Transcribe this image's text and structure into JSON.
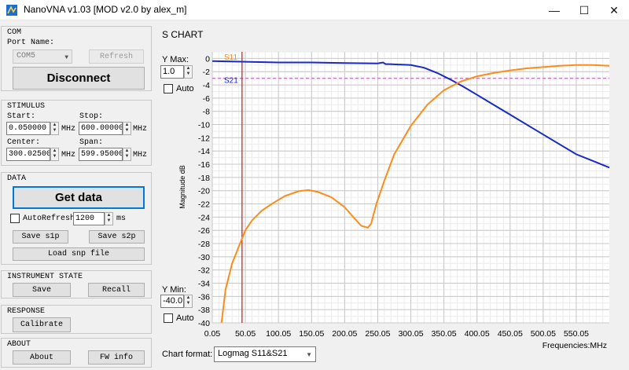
{
  "window": {
    "title": "NanoVNA v1.03 [MOD v2.0 by alex_m]",
    "minimize_glyph": "—",
    "maximize_glyph": "☐",
    "close_glyph": "✕"
  },
  "com": {
    "group_title": "COM",
    "port_label": "Port Name:",
    "port_value": "COM5",
    "refresh_label": "Refresh",
    "disconnect_label": "Disconnect"
  },
  "stimulus": {
    "group_title": "STIMULUS",
    "start_label": "Start:",
    "start_value": "0.050000",
    "stop_label": "Stop:",
    "stop_value": "600.000000",
    "center_label": "Center:",
    "center_value": "300.025000",
    "span_label": "Span:",
    "span_value": "599.950000",
    "unit": "MHz"
  },
  "data_group": {
    "group_title": "DATA",
    "get_data_label": "Get data",
    "autorefresh_label": "AutoRefresh",
    "autorefresh_checked": false,
    "interval_value": "1200",
    "interval_unit": "ms",
    "save_s1p_label": "Save s1p",
    "save_s2p_label": "Save s2p",
    "load_snp_label": "Load snp file"
  },
  "instrument_state": {
    "group_title": "INSTRUMENT STATE",
    "save_label": "Save",
    "recall_label": "Recall"
  },
  "response": {
    "group_title": "RESPONSE",
    "calibrate_label": "Calibrate"
  },
  "about": {
    "group_title": "ABOUT",
    "about_label": "About",
    "fw_info_label": "FW info"
  },
  "schart": {
    "group_title": "S CHART",
    "ymax_label": "Y Max:",
    "ymax_value": "1.0",
    "ymin_label": "Y Min:",
    "ymin_value": "-40.0",
    "auto_label_top": "Auto",
    "auto_label_bottom": "Auto",
    "chart_format_label": "Chart format:",
    "chart_format_value": "Logmag S11&S21"
  },
  "colors": {
    "s11": "#ff8c1a",
    "s21": "#1a28c8",
    "marker": "#cc1111",
    "ref_line": "#ff55ff",
    "grid": "#c8c8c8",
    "accent_focus": "#0078d7"
  },
  "chart_data": {
    "type": "line",
    "xlabel": "Frequencies:MHz",
    "ylabel": "Magnitude dB",
    "xlim": [
      0.05,
      600.0
    ],
    "ylim": [
      -40,
      1
    ],
    "x_ticks": [
      "0.05",
      "50.05",
      "100.05",
      "150.05",
      "200.05",
      "250.05",
      "300.05",
      "350.05",
      "400.05",
      "450.05",
      "500.05",
      "550.05"
    ],
    "y_ticks": [
      "0",
      "-2",
      "-4",
      "-6",
      "-8",
      "-10",
      "-12",
      "-14",
      "-16",
      "-18",
      "-20",
      "-22",
      "-24",
      "-26",
      "-28",
      "-30",
      "-32",
      "-34",
      "-36",
      "-38",
      "-40"
    ],
    "grid": true,
    "marker_x": 45,
    "reference_level": -3,
    "series": [
      {
        "name": "S11",
        "x": [
          14,
          20,
          30,
          40,
          50,
          60,
          75,
          90,
          110,
          130,
          145,
          160,
          180,
          200,
          215,
          225,
          235,
          240,
          248,
          260,
          275,
          300,
          325,
          350,
          375,
          400,
          425,
          450,
          475,
          500,
          525,
          550,
          575,
          600
        ],
        "values": [
          -40,
          -35,
          -31,
          -28.5,
          -26,
          -24.5,
          -23,
          -22,
          -20.8,
          -20.1,
          -19.9,
          -20.2,
          -21,
          -22.5,
          -24.2,
          -25.3,
          -25.6,
          -25,
          -22,
          -18.5,
          -14.5,
          -10.2,
          -7,
          -4.8,
          -3.5,
          -2.7,
          -2.2,
          -1.8,
          -1.5,
          -1.3,
          -1.1,
          -1.0,
          -1.0,
          -1.1
        ]
      },
      {
        "name": "S21",
        "x": [
          0.05,
          50,
          100,
          150,
          200,
          250,
          258,
          262,
          268,
          300,
          320,
          340,
          360,
          380,
          400,
          450,
          500,
          550,
          575,
          600
        ],
        "values": [
          -0.4,
          -0.5,
          -0.6,
          -0.6,
          -0.7,
          -0.75,
          -0.6,
          -0.85,
          -0.85,
          -1.0,
          -1.4,
          -2.2,
          -3.2,
          -4.3,
          -5.5,
          -8.5,
          -11.5,
          -14.5,
          -15.5,
          -16.5
        ]
      }
    ]
  }
}
